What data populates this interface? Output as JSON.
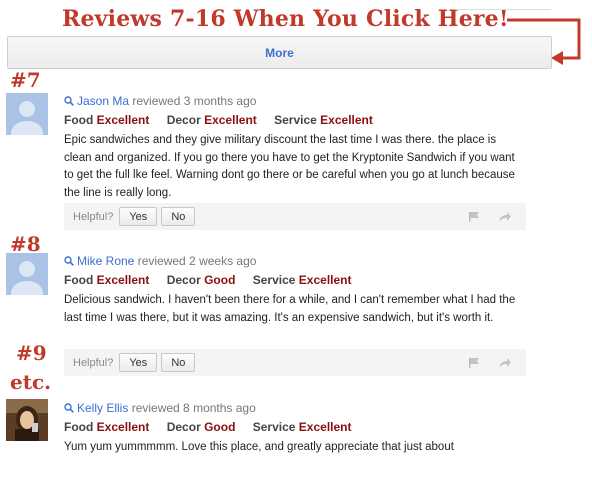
{
  "banner": {
    "text": "Reviews 7-16 When You Click Here!"
  },
  "more_button": {
    "label": "More"
  },
  "markers": [
    "#7",
    "#8",
    "#9",
    "etc."
  ],
  "colors": {
    "accent_red": "#c0392b",
    "link_blue": "#3b6fd0",
    "rating_red": "#8a1010"
  },
  "helpful": {
    "label": "Helpful?",
    "yes": "Yes",
    "no": "No"
  },
  "icons": [
    "search-icon",
    "flag-icon",
    "share-icon",
    "arrow-icon",
    "default-avatar-icon"
  ],
  "reviews": [
    {
      "author": "Jason Ma",
      "when": "reviewed 3 months ago",
      "ratings": [
        {
          "label": "Food",
          "value": "Excellent"
        },
        {
          "label": "Decor",
          "value": "Excellent"
        },
        {
          "label": "Service",
          "value": "Excellent"
        }
      ],
      "text": "Epic sandwiches and they give military discount the last time I was there. the place is clean and organized. If you go there you have to get the Kryptonite Sandwich if you want to get the full lke feel. Warning dont go there or be careful when you go at lunch because the line is really long."
    },
    {
      "author": "Mike Rone",
      "when": "reviewed 2 weeks ago",
      "ratings": [
        {
          "label": "Food",
          "value": "Excellent"
        },
        {
          "label": "Decor",
          "value": "Good"
        },
        {
          "label": "Service",
          "value": "Excellent"
        }
      ],
      "text": "Delicious sandwich. I haven't been there for a while, and I can't remember what I had the last time I was there, but it was amazing. It's an expensive sandwich, but it's worth it."
    },
    {
      "author": "Kelly Ellis",
      "when": "reviewed 8 months ago",
      "ratings": [
        {
          "label": "Food",
          "value": "Excellent"
        },
        {
          "label": "Decor",
          "value": "Good"
        },
        {
          "label": "Service",
          "value": "Excellent"
        }
      ],
      "text": "Yum yum yummmmm. Love this place, and greatly appreciate that just about"
    }
  ]
}
